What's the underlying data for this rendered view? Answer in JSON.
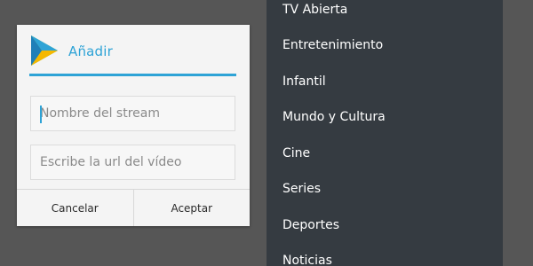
{
  "dialog": {
    "title": "Añadir",
    "name_field_placeholder": "Nombre del stream",
    "url_field_placeholder": "Escribe la url del vídeo",
    "cancel_label": "Cancelar",
    "accept_label": "Aceptar",
    "logo_icon": "play-logo-icon"
  },
  "menu": {
    "items": [
      {
        "label": "TV Abierta"
      },
      {
        "label": "Entretenimiento"
      },
      {
        "label": "Infantil"
      },
      {
        "label": "Mundo y Cultura"
      },
      {
        "label": "Cine"
      },
      {
        "label": "Series"
      },
      {
        "label": "Deportes"
      },
      {
        "label": "Noticias"
      }
    ]
  },
  "colors": {
    "accent": "#2ea3d6",
    "menu_background": "#353b41",
    "screen_background": "#565656",
    "dialog_background": "#f4f4f4"
  }
}
